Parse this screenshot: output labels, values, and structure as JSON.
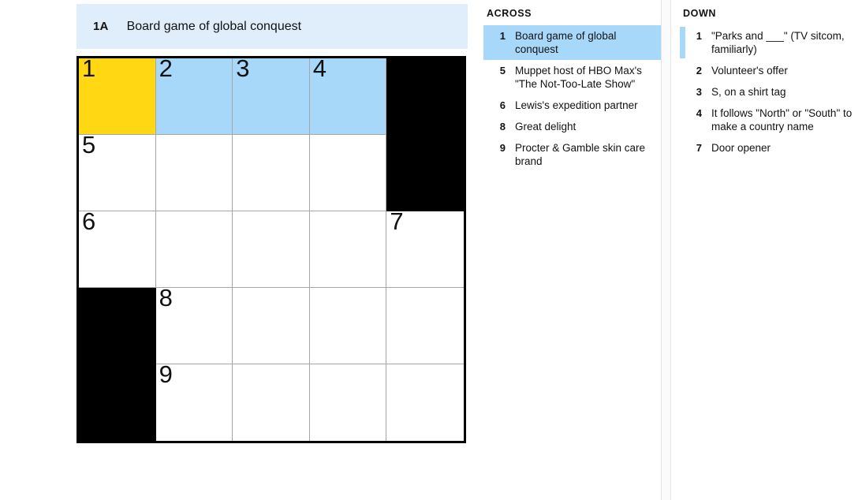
{
  "banner": {
    "number": "1A",
    "clue": "Board game of global conquest"
  },
  "grid": {
    "rows": 5,
    "cols": 5,
    "colors": {
      "active": "#ffd712",
      "word_highlight": "#a7d8f9",
      "block": "#000000",
      "cell": "#ffffff",
      "border": "#000000",
      "inner_border": "#a6a6a6"
    },
    "cells": [
      [
        {
          "number": "1",
          "letter": "",
          "state": "active"
        },
        {
          "number": "2",
          "letter": "",
          "state": "inword"
        },
        {
          "number": "3",
          "letter": "",
          "state": "inword"
        },
        {
          "number": "4",
          "letter": "",
          "state": "inword"
        },
        {
          "number": "",
          "letter": "",
          "state": "block"
        }
      ],
      [
        {
          "number": "5",
          "letter": "",
          "state": "empty"
        },
        {
          "number": "",
          "letter": "",
          "state": "empty"
        },
        {
          "number": "",
          "letter": "",
          "state": "empty"
        },
        {
          "number": "",
          "letter": "",
          "state": "empty"
        },
        {
          "number": "",
          "letter": "",
          "state": "block"
        }
      ],
      [
        {
          "number": "6",
          "letter": "",
          "state": "empty"
        },
        {
          "number": "",
          "letter": "",
          "state": "empty"
        },
        {
          "number": "",
          "letter": "",
          "state": "empty"
        },
        {
          "number": "",
          "letter": "",
          "state": "empty"
        },
        {
          "number": "7",
          "letter": "",
          "state": "empty"
        }
      ],
      [
        {
          "number": "",
          "letter": "",
          "state": "block"
        },
        {
          "number": "8",
          "letter": "",
          "state": "empty"
        },
        {
          "number": "",
          "letter": "",
          "state": "empty"
        },
        {
          "number": "",
          "letter": "",
          "state": "empty"
        },
        {
          "number": "",
          "letter": "",
          "state": "empty"
        }
      ],
      [
        {
          "number": "",
          "letter": "",
          "state": "block"
        },
        {
          "number": "9",
          "letter": "",
          "state": "empty"
        },
        {
          "number": "",
          "letter": "",
          "state": "empty"
        },
        {
          "number": "",
          "letter": "",
          "state": "empty"
        },
        {
          "number": "",
          "letter": "",
          "state": "empty"
        }
      ]
    ]
  },
  "across": {
    "title": "ACROSS",
    "clues": [
      {
        "number": "1",
        "text": "Board game of global conquest",
        "state": "selected"
      },
      {
        "number": "5",
        "text": "Muppet host of HBO Max's \"The Not-Too-Late Show\"",
        "state": "normal"
      },
      {
        "number": "6",
        "text": "Lewis's expedition partner",
        "state": "normal"
      },
      {
        "number": "8",
        "text": "Great delight",
        "state": "normal"
      },
      {
        "number": "9",
        "text": "Procter & Gamble skin care brand",
        "state": "normal"
      }
    ]
  },
  "down": {
    "title": "DOWN",
    "clues": [
      {
        "number": "1",
        "text": "\"Parks and ___\" (TV sitcom, familiarly)",
        "state": "crossref"
      },
      {
        "number": "2",
        "text": "Volunteer's offer",
        "state": "normal"
      },
      {
        "number": "3",
        "text": "S, on a shirt tag",
        "state": "normal"
      },
      {
        "number": "4",
        "text": "It follows \"North\" or \"South\" to make a country name",
        "state": "normal"
      },
      {
        "number": "7",
        "text": "Door opener",
        "state": "normal"
      }
    ]
  }
}
